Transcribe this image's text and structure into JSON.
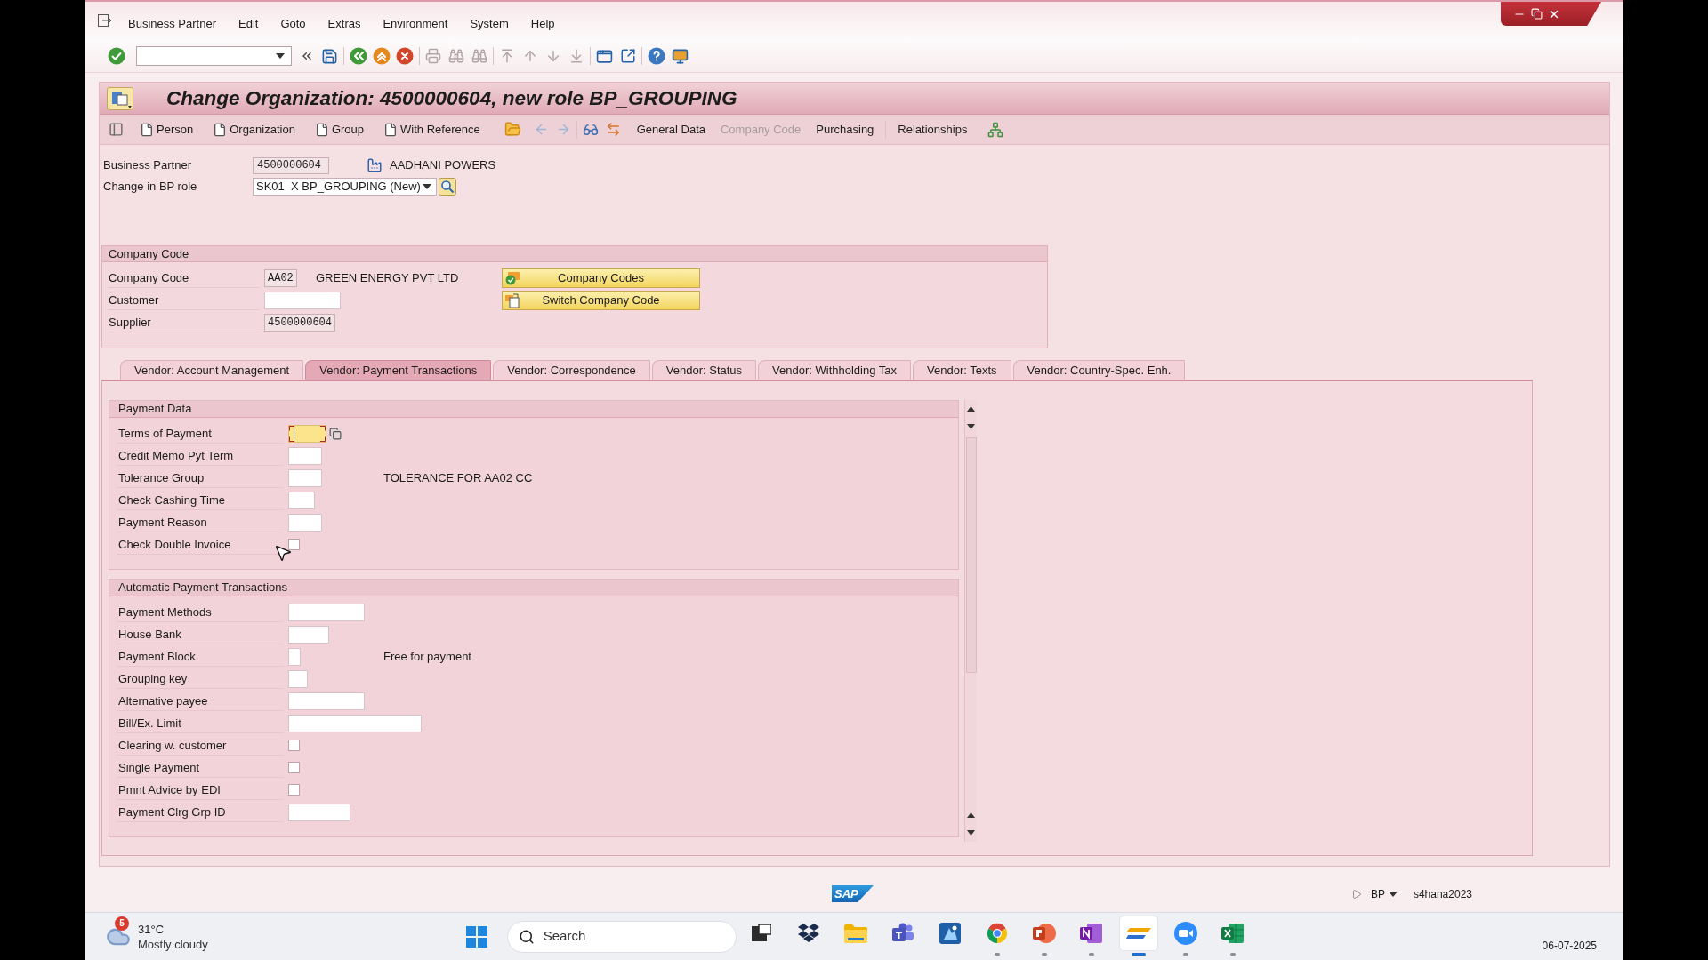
{
  "menu_bar": [
    "Business Partner",
    "Edit",
    "Goto",
    "Extras",
    "Environment",
    "System",
    "Help"
  ],
  "title": "Change Organization: 4500000604, new role BP_GROUPING",
  "app_toolbar": [
    {
      "kind": "create",
      "label": "Person",
      "disabled": false
    },
    {
      "kind": "create",
      "label": "Organization",
      "disabled": false
    },
    {
      "kind": "create",
      "label": "Group",
      "disabled": false
    },
    {
      "kind": "create",
      "label": "With Reference",
      "disabled": false
    },
    {
      "kind": "view",
      "label": "General Data",
      "disabled": false
    },
    {
      "kind": "view",
      "label": "Company Code",
      "disabled": true
    },
    {
      "kind": "view",
      "label": "Purchasing",
      "disabled": false
    },
    {
      "kind": "view",
      "label": "Relationships",
      "disabled": false
    }
  ],
  "partner": {
    "label": "Business Partner",
    "value": "4500000604",
    "name": "AADHANI POWERS"
  },
  "role": {
    "label": "Change in BP role",
    "value": "SK01  X BP_GROUPING (New)"
  },
  "company_code": {
    "title": "Company Code",
    "fields": [
      {
        "label": "Company Code",
        "value": "AA02",
        "description": "GREEN ENERGY PVT LTD",
        "editable": false
      },
      {
        "label": "Customer",
        "editable": true
      },
      {
        "label": "Supplier",
        "value": "4500000604",
        "editable": false
      }
    ],
    "buttons": [
      {
        "kind": "codes",
        "label": "Company Codes"
      },
      {
        "kind": "switch",
        "label": "Switch Company Code"
      }
    ]
  },
  "tabs": [
    {
      "label": "Vendor: Account Management",
      "selected": false
    },
    {
      "label": "Vendor: Payment Transactions",
      "selected": true
    },
    {
      "label": "Vendor: Correspondence",
      "selected": false
    },
    {
      "label": "Vendor: Status",
      "selected": false
    },
    {
      "label": "Vendor: Withholding Tax",
      "selected": false
    },
    {
      "label": "Vendor: Texts",
      "selected": false
    },
    {
      "label": "Vendor: Country-Spec. Enh.",
      "selected": false
    }
  ],
  "groups": [
    {
      "title": "Payment Data",
      "fields": [
        {
          "kind": "input",
          "label": "Terms of Payment",
          "focused": true
        },
        {
          "kind": "input",
          "label": "Credit Memo Pyt Term",
          "focused": false
        },
        {
          "kind": "input",
          "label": "Tolerance Group",
          "focused": false,
          "description": "TOLERANCE FOR AA02 CC"
        },
        {
          "kind": "input",
          "label": "Check Cashing Time",
          "focused": false
        },
        {
          "kind": "input",
          "label": "Payment Reason",
          "focused": false
        },
        {
          "kind": "checkbox",
          "label": "Check Double Invoice",
          "checked": false
        }
      ]
    },
    {
      "title": "Automatic Payment Transactions",
      "fields": [
        {
          "kind": "input",
          "label": "Payment Methods",
          "focused": false
        },
        {
          "kind": "input",
          "label": "House Bank",
          "focused": false
        },
        {
          "kind": "input",
          "label": "Payment Block",
          "focused": false,
          "description": "Free for payment"
        },
        {
          "kind": "input",
          "label": "Grouping key",
          "focused": false
        },
        {
          "kind": "input",
          "label": "Alternative payee",
          "focused": false
        },
        {
          "kind": "input",
          "label": "Bill/Ex. Limit",
          "focused": false
        },
        {
          "kind": "checkbox",
          "label": "Clearing w. customer",
          "checked": false
        },
        {
          "kind": "checkbox",
          "label": "Single Payment",
          "checked": false
        },
        {
          "kind": "checkbox",
          "label": "Pmnt Advice by EDI",
          "checked": false
        },
        {
          "kind": "input",
          "label": "Payment Clrg Grp ID",
          "focused": false
        }
      ]
    }
  ],
  "status_bar": {
    "logo": "SAP",
    "transaction": "BP",
    "server": "s4hana2023"
  },
  "taskbar": {
    "weather": {
      "badge": "5",
      "temperature": "31°C",
      "condition": "Mostly cloudy"
    },
    "search": {
      "placeholder": "Search"
    },
    "apps": [
      {
        "kind": "task-view",
        "running": false,
        "selected": false
      },
      {
        "kind": "dropbox",
        "running": false,
        "selected": false
      },
      {
        "kind": "explorer",
        "running": false,
        "selected": false
      },
      {
        "kind": "teams",
        "running": false,
        "selected": false
      },
      {
        "kind": "remote",
        "running": false,
        "selected": false
      },
      {
        "kind": "chrome",
        "running": true,
        "selected": false
      },
      {
        "kind": "powerpoint",
        "running": true,
        "selected": false
      },
      {
        "kind": "onenote",
        "running": true,
        "selected": false
      },
      {
        "kind": "sap",
        "running": true,
        "selected": true
      },
      {
        "kind": "zoom",
        "running": true,
        "selected": false
      },
      {
        "kind": "excel",
        "running": true,
        "selected": false
      }
    ],
    "date": "06-07-2025"
  }
}
